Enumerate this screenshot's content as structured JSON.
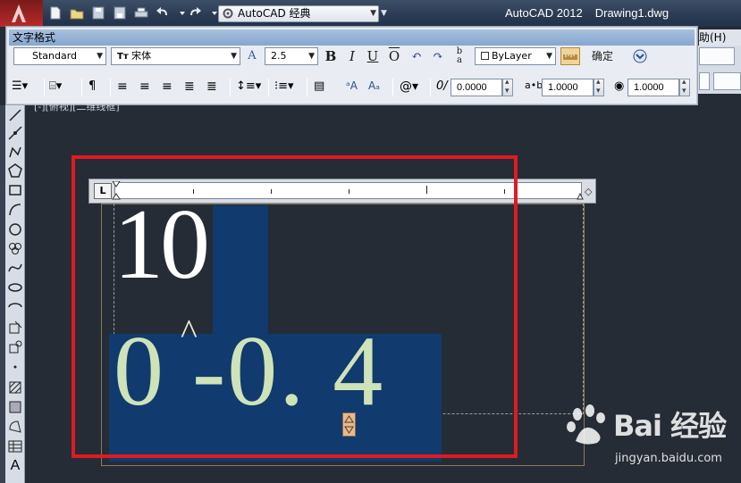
{
  "title_bar": {
    "workspace": "AutoCAD 经典",
    "app_name": "AutoCAD 2012",
    "document": "Drawing1.dwg"
  },
  "menu": {
    "help_partial": "助(H)"
  },
  "text_formatting": {
    "title": "文字格式",
    "style": "Standard",
    "font": "宋体",
    "height": "2.5",
    "bold": "B",
    "italic": "I",
    "underline": "U",
    "overline": "O",
    "color": "ByLayer",
    "ok_label": "确定",
    "oblique_angle": "0.0000",
    "tracking": "1.0000",
    "width_factor": "1.0000"
  },
  "viewport_label": "[-][俯视][二维线框]",
  "editor": {
    "line1": "10",
    "caret_char": "^",
    "line2": "0 -0. 4"
  },
  "watermark": {
    "brand": "Bai 经验",
    "url": "jingyan.baidu.com"
  },
  "colors": {
    "selection": "#113a6e",
    "highlight_frame": "#e01a22",
    "canvas": "#262c35"
  }
}
